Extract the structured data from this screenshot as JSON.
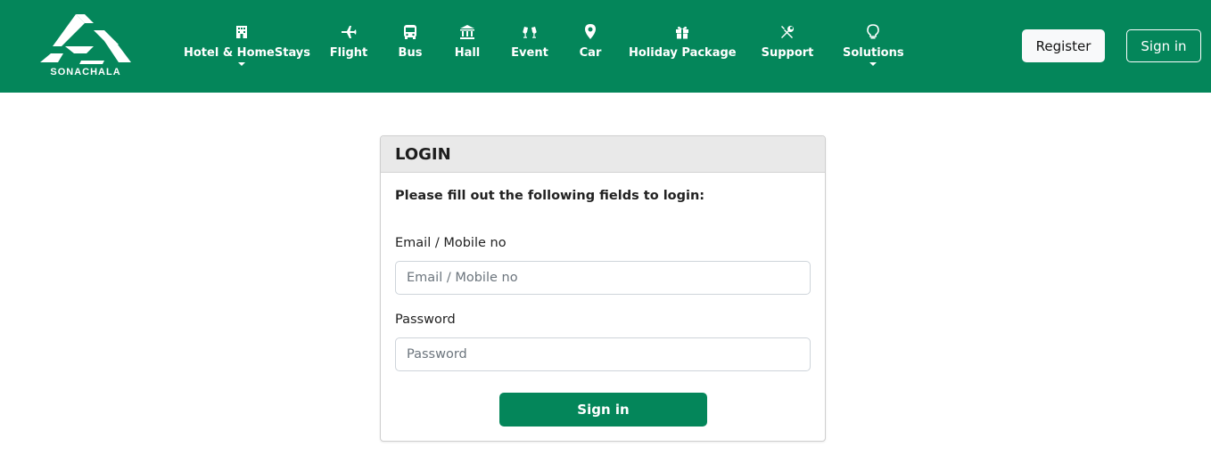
{
  "brand": {
    "name": "SONACHALA"
  },
  "colors": {
    "primary": "#04865a",
    "header_bg": "#e9e9e9"
  },
  "nav": {
    "items": [
      {
        "label": "Hotel & HomeStays",
        "icon": "hotel-icon",
        "dropdown": true
      },
      {
        "label": "Flight",
        "icon": "plane-icon",
        "dropdown": false
      },
      {
        "label": "Bus",
        "icon": "bus-icon",
        "dropdown": false
      },
      {
        "label": "Hall",
        "icon": "hall-icon",
        "dropdown": false
      },
      {
        "label": "Event",
        "icon": "event-icon",
        "dropdown": false
      },
      {
        "label": "Car",
        "icon": "map-pin-icon",
        "dropdown": false
      },
      {
        "label": "Holiday Package",
        "icon": "gift-icon",
        "dropdown": false
      },
      {
        "label": "Support",
        "icon": "tools-icon",
        "dropdown": false
      },
      {
        "label": "Solutions",
        "icon": "lightbulb-icon",
        "dropdown": true
      }
    ]
  },
  "auth": {
    "register_label": "Register",
    "signin_label": "Sign in"
  },
  "login": {
    "title": "LOGIN",
    "instructions": "Please fill out the following fields to login:",
    "email": {
      "label": "Email / Mobile no",
      "placeholder": "Email / Mobile no",
      "value": ""
    },
    "password": {
      "label": "Password",
      "placeholder": "Password",
      "value": ""
    },
    "submit_label": "Sign in"
  }
}
